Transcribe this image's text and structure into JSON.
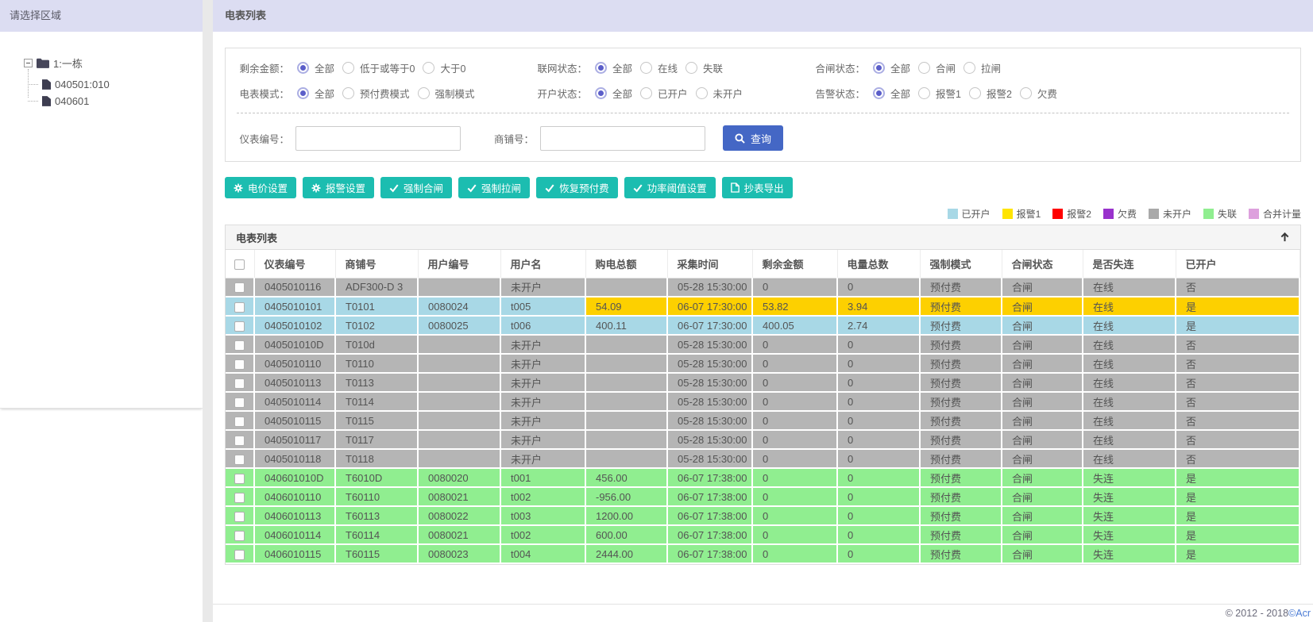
{
  "sidebar": {
    "title": "请选择区域",
    "tree": {
      "root_label": "1:一栋",
      "children": [
        "040501:010",
        "040601"
      ]
    }
  },
  "main": {
    "title": "电表列表",
    "filters": [
      {
        "key": "remaining-amount",
        "label": "剩余金额：",
        "options": [
          "全部",
          "低于或等于0",
          "大于0"
        ],
        "selected": 0
      },
      {
        "key": "network-status",
        "label": "联网状态：",
        "options": [
          "全部",
          "在线",
          "失联"
        ],
        "selected": 0
      },
      {
        "key": "valve-status",
        "label": "合闸状态：",
        "options": [
          "全部",
          "合闸",
          "拉闸"
        ],
        "selected": 0
      },
      {
        "key": "meter-mode",
        "label": "电表模式：",
        "options": [
          "全部",
          "预付费模式",
          "强制模式"
        ],
        "selected": 0
      },
      {
        "key": "account-status",
        "label": "开户状态：",
        "options": [
          "全部",
          "已开户",
          "未开户"
        ],
        "selected": 0
      },
      {
        "key": "alarm-status",
        "label": "告警状态：",
        "options": [
          "全部",
          "报警1",
          "报警2",
          "欠费"
        ],
        "selected": 0
      }
    ],
    "search": {
      "meter_label": "仪表编号：",
      "meter_value": "",
      "shop_label": "商铺号：",
      "shop_value": "",
      "query_label": "查询"
    },
    "actions": [
      {
        "key": "price-settings",
        "icon": "gear",
        "label": "电价设置"
      },
      {
        "key": "alarm-settings",
        "icon": "gear",
        "label": "报警设置"
      },
      {
        "key": "force-close",
        "icon": "check",
        "label": "强制合闸"
      },
      {
        "key": "force-trip",
        "icon": "check",
        "label": "强制拉闸"
      },
      {
        "key": "restore-prepaid",
        "icon": "check",
        "label": "恢复预付费"
      },
      {
        "key": "power-threshold",
        "icon": "check",
        "label": "功率阈值设置"
      },
      {
        "key": "meter-export",
        "icon": "file",
        "label": "抄表导出"
      }
    ],
    "legend": [
      {
        "label": "已开户",
        "color": "#a8d8e6"
      },
      {
        "label": "报警1",
        "color": "#ffe400"
      },
      {
        "label": "报警2",
        "color": "#ff0000"
      },
      {
        "label": "欠费",
        "color": "#9932cc"
      },
      {
        "label": "未开户",
        "color": "#a9a9a9"
      },
      {
        "label": "失联",
        "color": "#90ee90"
      },
      {
        "label": "合并计量",
        "color": "#dda0dd"
      }
    ],
    "table": {
      "panel_title": "电表列表",
      "columns": [
        "仪表编号",
        "商铺号",
        "用户编号",
        "用户名",
        "购电总额",
        "采集时间",
        "剩余金额",
        "电量总数",
        "强制模式",
        "合闸状态",
        "是否失连",
        "已开户"
      ],
      "row_colors": {
        "gray": "#b5b5b5",
        "blue": "#a8d8e6",
        "yellow": "#fdd000",
        "green": "#90ee90"
      },
      "rows": [
        {
          "style": "gray",
          "cells": [
            "0405010116",
            "ADF300-D 3",
            "",
            "未开户",
            "",
            "05-28 15:30:00",
            "0",
            "0",
            "预付费",
            "合闸",
            "在线",
            "否"
          ]
        },
        {
          "style": "blue_yellow",
          "cells": [
            "0405010101",
            "T0101",
            "0080024",
            "t005",
            "54.09",
            "06-07 17:30:00",
            "53.82",
            "3.94",
            "预付费",
            "合闸",
            "在线",
            "是"
          ]
        },
        {
          "style": "blue",
          "cells": [
            "0405010102",
            "T0102",
            "0080025",
            "t006",
            "400.11",
            "06-07 17:30:00",
            "400.05",
            "2.74",
            "预付费",
            "合闸",
            "在线",
            "是"
          ]
        },
        {
          "style": "gray",
          "cells": [
            "040501010D",
            "T010d",
            "",
            "未开户",
            "",
            "05-28 15:30:00",
            "0",
            "0",
            "预付费",
            "合闸",
            "在线",
            "否"
          ]
        },
        {
          "style": "gray",
          "cells": [
            "0405010110",
            "T0110",
            "",
            "未开户",
            "",
            "05-28 15:30:00",
            "0",
            "0",
            "预付费",
            "合闸",
            "在线",
            "否"
          ]
        },
        {
          "style": "gray",
          "cells": [
            "0405010113",
            "T0113",
            "",
            "未开户",
            "",
            "05-28 15:30:00",
            "0",
            "0",
            "预付费",
            "合闸",
            "在线",
            "否"
          ]
        },
        {
          "style": "gray",
          "cells": [
            "0405010114",
            "T0114",
            "",
            "未开户",
            "",
            "05-28 15:30:00",
            "0",
            "0",
            "预付费",
            "合闸",
            "在线",
            "否"
          ]
        },
        {
          "style": "gray",
          "cells": [
            "0405010115",
            "T0115",
            "",
            "未开户",
            "",
            "05-28 15:30:00",
            "0",
            "0",
            "预付费",
            "合闸",
            "在线",
            "否"
          ]
        },
        {
          "style": "gray",
          "cells": [
            "0405010117",
            "T0117",
            "",
            "未开户",
            "",
            "05-28 15:30:00",
            "0",
            "0",
            "预付费",
            "合闸",
            "在线",
            "否"
          ]
        },
        {
          "style": "gray",
          "cells": [
            "0405010118",
            "T0118",
            "",
            "未开户",
            "",
            "05-28 15:30:00",
            "0",
            "0",
            "预付费",
            "合闸",
            "在线",
            "否"
          ]
        },
        {
          "style": "green",
          "cells": [
            "040601010D",
            "T6010D",
            "0080020",
            "t001",
            "456.00",
            "06-07 17:38:00",
            "0",
            "0",
            "预付费",
            "合闸",
            "失连",
            "是"
          ]
        },
        {
          "style": "green",
          "cells": [
            "0406010110",
            "T60110",
            "0080021",
            "t002",
            "-956.00",
            "06-07 17:38:00",
            "0",
            "0",
            "预付费",
            "合闸",
            "失连",
            "是"
          ]
        },
        {
          "style": "green",
          "cells": [
            "0406010113",
            "T60113",
            "0080022",
            "t003",
            "1200.00",
            "06-07 17:38:00",
            "0",
            "0",
            "预付费",
            "合闸",
            "失连",
            "是"
          ]
        },
        {
          "style": "green",
          "cells": [
            "0406010114",
            "T60114",
            "0080021",
            "t002",
            "600.00",
            "06-07 17:38:00",
            "0",
            "0",
            "预付费",
            "合闸",
            "失连",
            "是"
          ]
        },
        {
          "style": "green",
          "cells": [
            "0406010115",
            "T60115",
            "0080023",
            "t004",
            "2444.00",
            "06-07 17:38:00",
            "0",
            "0",
            "预付费",
            "合闸",
            "失连",
            "是"
          ]
        }
      ]
    }
  },
  "footer": {
    "copyright": "© 2012 - 2018 ",
    "brand": "©Acr"
  }
}
